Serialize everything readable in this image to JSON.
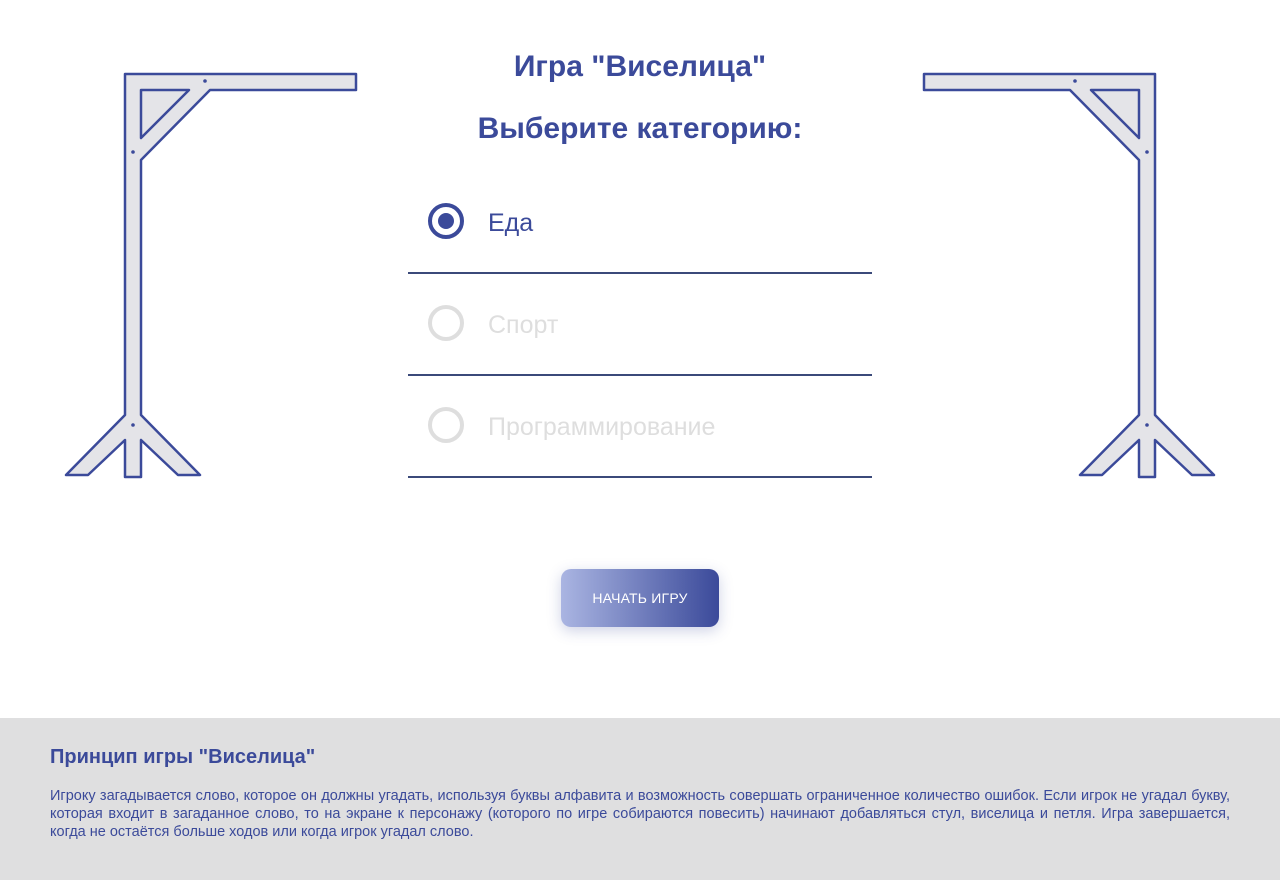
{
  "header": {
    "title": "Игра \"Виселица\"",
    "subtitle": "Выберите категорию:"
  },
  "categories": [
    {
      "label": "Еда",
      "selected": true
    },
    {
      "label": "Спорт",
      "selected": false
    },
    {
      "label": "Программирование",
      "selected": false
    }
  ],
  "start_button": {
    "label": "НАЧАТЬ ИГРУ"
  },
  "footer": {
    "title": "Принцип игры \"Виселица\"",
    "text": "Игроку загадывается слово, которое он должны угадать, используя буквы алфавита и возможность совершать ограниченное количество ошибок. Если игрок не угадал букву, которая входит в загаданное слово, то на экране к персонажу (которого по игре собираются повесить) начинают добавляться стул, виселица и петля. Игра завершается, когда не остаётся больше ходов или когда игрок угадал слово."
  },
  "colors": {
    "accent": "#3b4a9a",
    "inactive": "#dedede",
    "footer_bg": "#dfdfe0",
    "gallows_fill": "#e4e4e8"
  },
  "icons": {
    "left_decoration": "gallows-icon",
    "right_decoration": "gallows-icon",
    "radio_checked": "radio-checked-icon",
    "radio_unchecked": "radio-unchecked-icon"
  }
}
